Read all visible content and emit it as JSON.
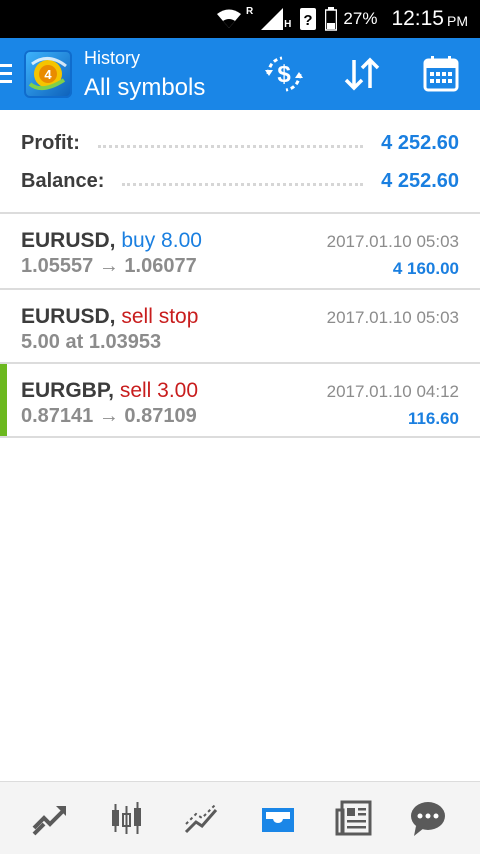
{
  "status_bar": {
    "roaming_label": "R",
    "network_label": "H",
    "battery_percent": "27%",
    "time": "12:15",
    "ampm": "PM"
  },
  "app_bar": {
    "title": "History",
    "subtitle": "All symbols",
    "accent_color": "#1a86e7"
  },
  "summary": {
    "profit_label": "Profit:",
    "profit_value": "4 252.60",
    "balance_label": "Balance:",
    "balance_value": "4 252.60"
  },
  "trades": [
    {
      "symbol": "EURUSD,",
      "action": "buy 8.00",
      "prices": "1.05557 → 1.06077",
      "time": "2017.01.10 05:03",
      "profit": "4 160.00"
    },
    {
      "symbol": "EURUSD,",
      "action": "sell stop",
      "prices": "5.00 at 1.03953",
      "time": "2017.01.10 05:03",
      "profit": ""
    },
    {
      "symbol": "EURGBP,",
      "action": "sell 3.00",
      "prices": "0.87141 → 0.87109",
      "time": "2017.01.10 04:12",
      "profit": "116.60"
    }
  ],
  "bottom_nav": {
    "items": [
      "trade-icon",
      "chart-icon",
      "history-trend-icon",
      "inbox-icon",
      "news-icon",
      "chat-icon"
    ],
    "active_color": "#1a86e7",
    "icon_color": "#5a5a5a"
  }
}
